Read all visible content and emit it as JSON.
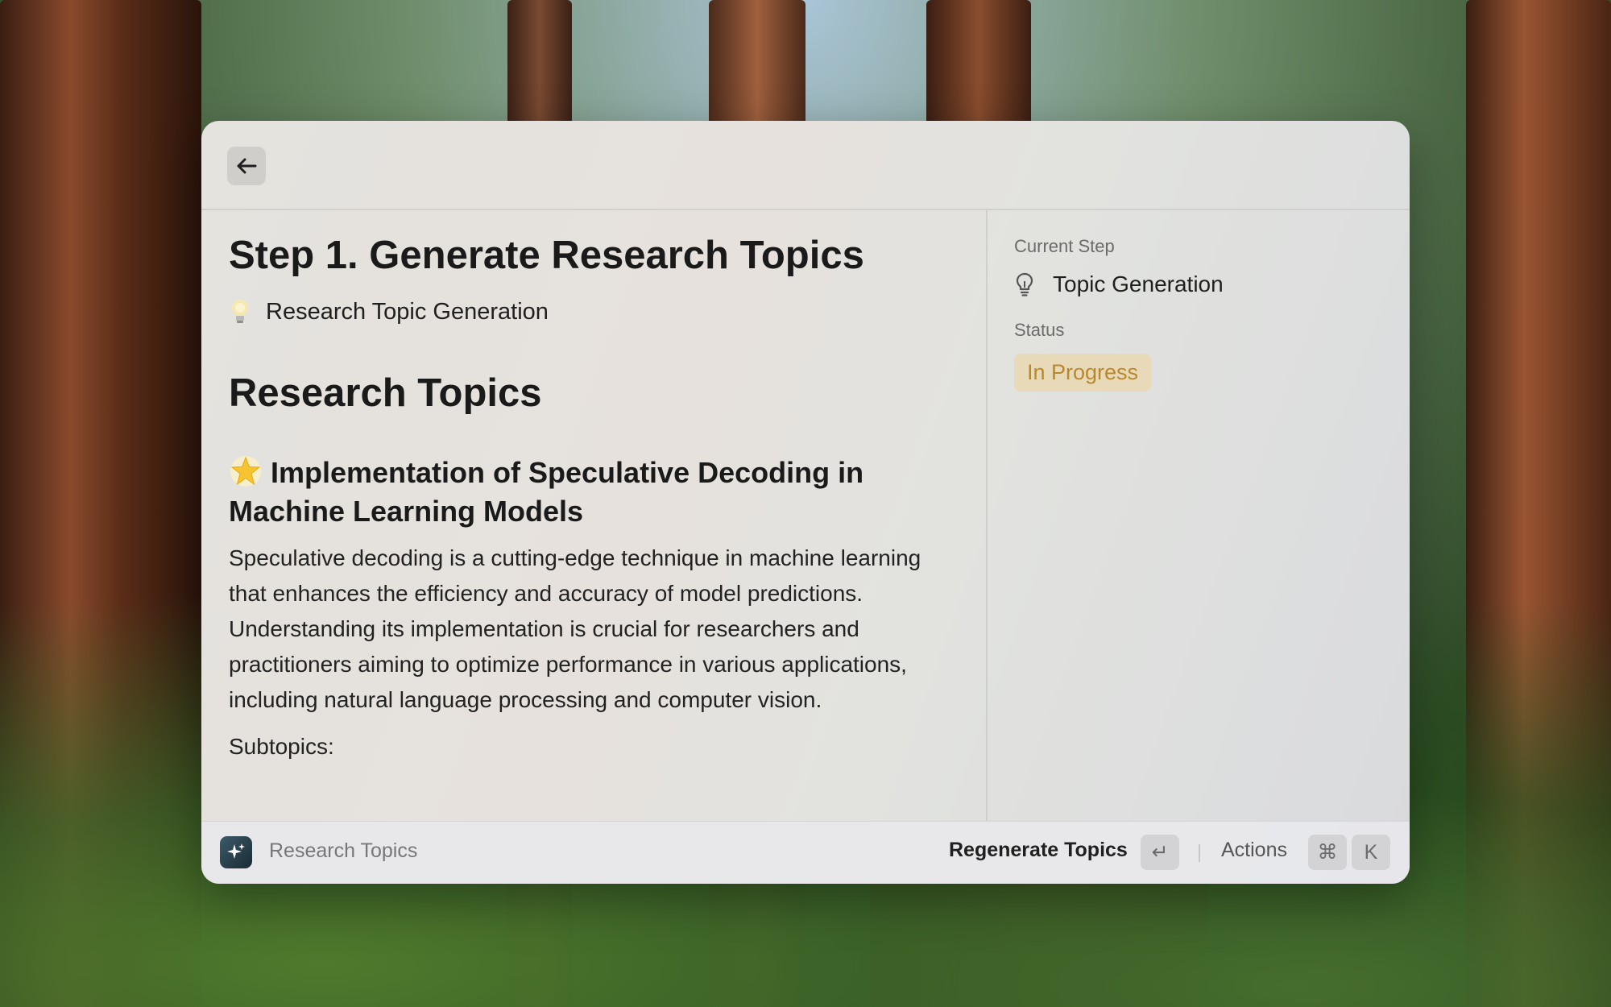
{
  "main": {
    "heading": "Step 1. Generate Research Topics",
    "sub_label": "Research Topic Generation",
    "section_title": "Research Topics",
    "topic": {
      "title": "Implementation of Speculative Decoding in Machine Learning Models",
      "description": "Speculative decoding is a cutting-edge technique in machine learning that enhances the efficiency and accuracy of model predictions. Understanding its implementation is crucial for researchers and practitioners aiming to optimize performance in various applications, including natural language processing and computer vision.",
      "subtopics_label": "Subtopics:"
    }
  },
  "side": {
    "current_step_label": "Current Step",
    "current_step_value": "Topic Generation",
    "status_label": "Status",
    "status_value": "In Progress"
  },
  "bottom": {
    "title": "Research Topics",
    "primary_action": "Regenerate Topics",
    "primary_key": "↵",
    "actions_label": "Actions",
    "actions_keys": [
      "⌘",
      "K"
    ]
  },
  "icons": {
    "back": "arrow-left-icon",
    "bulb_emoji": "lightbulb-icon",
    "star_emoji": "glowing-star-icon",
    "step": "lightbulb-outline-icon",
    "app": "sparkles-icon"
  },
  "colors": {
    "status_text": "#b8892c",
    "status_bg": "#e8d9b8"
  }
}
